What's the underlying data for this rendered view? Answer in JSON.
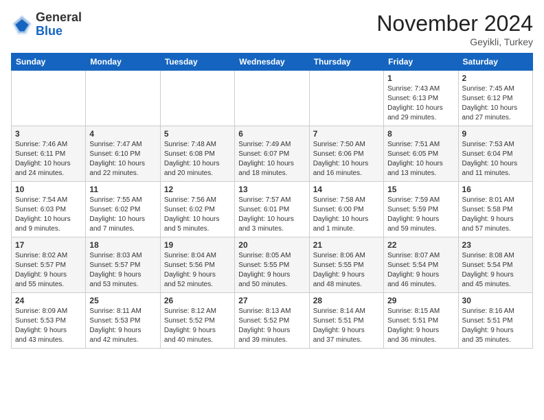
{
  "header": {
    "logo_line1": "General",
    "logo_line2": "Blue",
    "month": "November 2024",
    "location": "Geyikli, Turkey"
  },
  "weekdays": [
    "Sunday",
    "Monday",
    "Tuesday",
    "Wednesday",
    "Thursday",
    "Friday",
    "Saturday"
  ],
  "weeks": [
    [
      {
        "day": "",
        "info": ""
      },
      {
        "day": "",
        "info": ""
      },
      {
        "day": "",
        "info": ""
      },
      {
        "day": "",
        "info": ""
      },
      {
        "day": "",
        "info": ""
      },
      {
        "day": "1",
        "info": "Sunrise: 7:43 AM\nSunset: 6:13 PM\nDaylight: 10 hours\nand 29 minutes."
      },
      {
        "day": "2",
        "info": "Sunrise: 7:45 AM\nSunset: 6:12 PM\nDaylight: 10 hours\nand 27 minutes."
      }
    ],
    [
      {
        "day": "3",
        "info": "Sunrise: 7:46 AM\nSunset: 6:11 PM\nDaylight: 10 hours\nand 24 minutes."
      },
      {
        "day": "4",
        "info": "Sunrise: 7:47 AM\nSunset: 6:10 PM\nDaylight: 10 hours\nand 22 minutes."
      },
      {
        "day": "5",
        "info": "Sunrise: 7:48 AM\nSunset: 6:08 PM\nDaylight: 10 hours\nand 20 minutes."
      },
      {
        "day": "6",
        "info": "Sunrise: 7:49 AM\nSunset: 6:07 PM\nDaylight: 10 hours\nand 18 minutes."
      },
      {
        "day": "7",
        "info": "Sunrise: 7:50 AM\nSunset: 6:06 PM\nDaylight: 10 hours\nand 16 minutes."
      },
      {
        "day": "8",
        "info": "Sunrise: 7:51 AM\nSunset: 6:05 PM\nDaylight: 10 hours\nand 13 minutes."
      },
      {
        "day": "9",
        "info": "Sunrise: 7:53 AM\nSunset: 6:04 PM\nDaylight: 10 hours\nand 11 minutes."
      }
    ],
    [
      {
        "day": "10",
        "info": "Sunrise: 7:54 AM\nSunset: 6:03 PM\nDaylight: 10 hours\nand 9 minutes."
      },
      {
        "day": "11",
        "info": "Sunrise: 7:55 AM\nSunset: 6:02 PM\nDaylight: 10 hours\nand 7 minutes."
      },
      {
        "day": "12",
        "info": "Sunrise: 7:56 AM\nSunset: 6:02 PM\nDaylight: 10 hours\nand 5 minutes."
      },
      {
        "day": "13",
        "info": "Sunrise: 7:57 AM\nSunset: 6:01 PM\nDaylight: 10 hours\nand 3 minutes."
      },
      {
        "day": "14",
        "info": "Sunrise: 7:58 AM\nSunset: 6:00 PM\nDaylight: 10 hours\nand 1 minute."
      },
      {
        "day": "15",
        "info": "Sunrise: 7:59 AM\nSunset: 5:59 PM\nDaylight: 9 hours\nand 59 minutes."
      },
      {
        "day": "16",
        "info": "Sunrise: 8:01 AM\nSunset: 5:58 PM\nDaylight: 9 hours\nand 57 minutes."
      }
    ],
    [
      {
        "day": "17",
        "info": "Sunrise: 8:02 AM\nSunset: 5:57 PM\nDaylight: 9 hours\nand 55 minutes."
      },
      {
        "day": "18",
        "info": "Sunrise: 8:03 AM\nSunset: 5:57 PM\nDaylight: 9 hours\nand 53 minutes."
      },
      {
        "day": "19",
        "info": "Sunrise: 8:04 AM\nSunset: 5:56 PM\nDaylight: 9 hours\nand 52 minutes."
      },
      {
        "day": "20",
        "info": "Sunrise: 8:05 AM\nSunset: 5:55 PM\nDaylight: 9 hours\nand 50 minutes."
      },
      {
        "day": "21",
        "info": "Sunrise: 8:06 AM\nSunset: 5:55 PM\nDaylight: 9 hours\nand 48 minutes."
      },
      {
        "day": "22",
        "info": "Sunrise: 8:07 AM\nSunset: 5:54 PM\nDaylight: 9 hours\nand 46 minutes."
      },
      {
        "day": "23",
        "info": "Sunrise: 8:08 AM\nSunset: 5:54 PM\nDaylight: 9 hours\nand 45 minutes."
      }
    ],
    [
      {
        "day": "24",
        "info": "Sunrise: 8:09 AM\nSunset: 5:53 PM\nDaylight: 9 hours\nand 43 minutes."
      },
      {
        "day": "25",
        "info": "Sunrise: 8:11 AM\nSunset: 5:53 PM\nDaylight: 9 hours\nand 42 minutes."
      },
      {
        "day": "26",
        "info": "Sunrise: 8:12 AM\nSunset: 5:52 PM\nDaylight: 9 hours\nand 40 minutes."
      },
      {
        "day": "27",
        "info": "Sunrise: 8:13 AM\nSunset: 5:52 PM\nDaylight: 9 hours\nand 39 minutes."
      },
      {
        "day": "28",
        "info": "Sunrise: 8:14 AM\nSunset: 5:51 PM\nDaylight: 9 hours\nand 37 minutes."
      },
      {
        "day": "29",
        "info": "Sunrise: 8:15 AM\nSunset: 5:51 PM\nDaylight: 9 hours\nand 36 minutes."
      },
      {
        "day": "30",
        "info": "Sunrise: 8:16 AM\nSunset: 5:51 PM\nDaylight: 9 hours\nand 35 minutes."
      }
    ]
  ]
}
